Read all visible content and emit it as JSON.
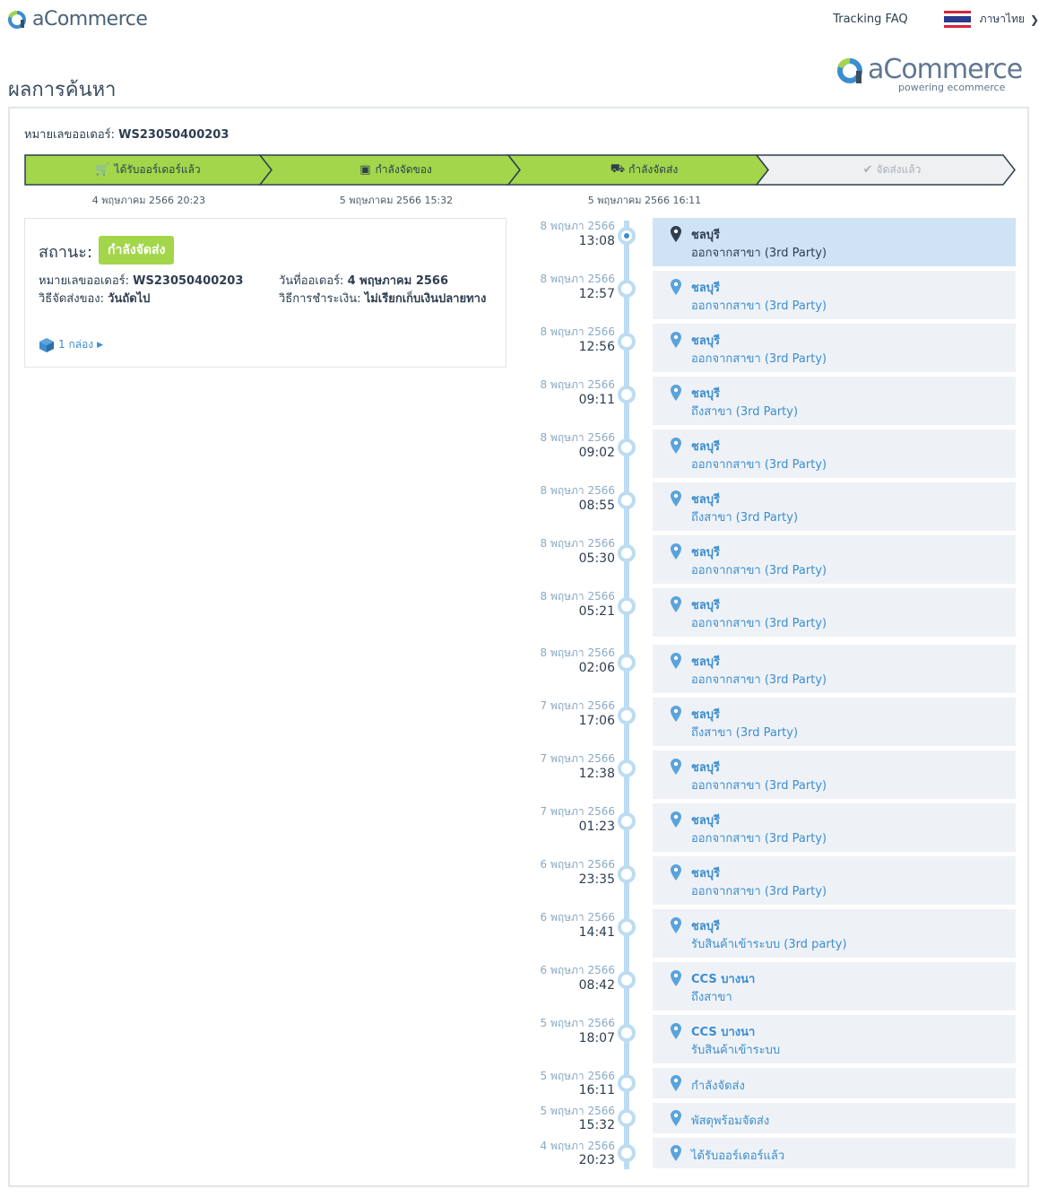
{
  "header": {
    "brand": "aCommerce",
    "faq": "Tracking FAQ",
    "language": "ภาษาไทย"
  },
  "page_title": "ผลการค้นหา",
  "big_logo": {
    "name": "aCommerce",
    "tagline": "powering ecommerce"
  },
  "order": {
    "label": "หมายเลขออเดอร์:",
    "number": "WS23050400203"
  },
  "steps": [
    {
      "label": "ได้รับออร์เดอร์แล้ว",
      "date": "4 พฤษภาคม 2566 20:23",
      "done": true
    },
    {
      "label": "กำลังจัดของ",
      "date": "5 พฤษภาคม 2566 15:32",
      "done": true
    },
    {
      "label": "กำลังจัดส่ง",
      "date": "5 พฤษภาคม 2566 16:11",
      "done": true
    },
    {
      "label": "จัดส่งแล้ว",
      "date": "",
      "done": false
    }
  ],
  "status": {
    "label": "สถานะ:",
    "badge": "กำลังจัดส่ง",
    "order_label": "หมายเลขออเดอร์:",
    "order_value": "WS23050400203",
    "ship_label": "วิธีจัดส่งของ:",
    "ship_value": "วันถัดไป",
    "date_label": "วันที่ออเดอร์:",
    "date_value": "4 พฤษภาคม 2566",
    "pay_label": "วิธีการชำระเงิน:",
    "pay_value": "ไม่เรียกเก็บเงินปลายทาง",
    "boxes": "1 กล่อง"
  },
  "events": [
    {
      "date": "8 พฤษภา 2566",
      "time": "13:08",
      "place": "ชลบุรี",
      "desc": "ออกจากสาขา (3rd Party)",
      "active": true
    },
    {
      "date": "8 พฤษภา 2566",
      "time": "12:57",
      "place": "ชลบุรี",
      "desc": "ออกจากสาขา (3rd Party)"
    },
    {
      "date": "8 พฤษภา 2566",
      "time": "12:56",
      "place": "ชลบุรี",
      "desc": "ออกจากสาขา (3rd Party)"
    },
    {
      "date": "8 พฤษภา 2566",
      "time": "09:11",
      "place": "ชลบุรี",
      "desc": "ถึงสาขา (3rd Party)"
    },
    {
      "date": "8 พฤษภา 2566",
      "time": "09:02",
      "place": "ชลบุรี",
      "desc": "ออกจากสาขา (3rd Party)"
    },
    {
      "date": "8 พฤษภา 2566",
      "time": "08:55",
      "place": "ชลบุรี",
      "desc": "ถึงสาขา (3rd Party)"
    },
    {
      "date": "8 พฤษภา 2566",
      "time": "05:30",
      "place": "ชลบุรี",
      "desc": "ออกจากสาขา (3rd Party)"
    },
    {
      "date": "8 พฤษภา 2566",
      "time": "05:21",
      "place": "ชลบุรี",
      "desc": "ออกจากสาขา (3rd Party)"
    },
    {
      "date": "8 พฤษภา 2566",
      "time": "02:06",
      "place": "ชลบุรี",
      "desc": "ออกจากสาขา (3rd Party)"
    },
    {
      "date": "7 พฤษภา 2566",
      "time": "17:06",
      "place": "ชลบุรี",
      "desc": "ถึงสาขา (3rd Party)"
    },
    {
      "date": "7 พฤษภา 2566",
      "time": "12:38",
      "place": "ชลบุรี",
      "desc": "ออกจากสาขา (3rd Party)"
    },
    {
      "date": "7 พฤษภา 2566",
      "time": "01:23",
      "place": "ชลบุรี",
      "desc": "ออกจากสาขา (3rd Party)"
    },
    {
      "date": "6 พฤษภา 2566",
      "time": "23:35",
      "place": "ชลบุรี",
      "desc": "ออกจากสาขา (3rd Party)"
    },
    {
      "date": "6 พฤษภา 2566",
      "time": "14:41",
      "place": "ชลบุรี",
      "desc": "รับสินค้าเข้าระบบ (3rd party)"
    },
    {
      "date": "6 พฤษภา 2566",
      "time": "08:42",
      "place": "CCS บางนา",
      "desc": "ถึงสาขา"
    },
    {
      "date": "5 พฤษภา 2566",
      "time": "18:07",
      "place": "CCS บางนา",
      "desc": "รับสินค้าเข้าระบบ"
    },
    {
      "date": "5 พฤษภา 2566",
      "time": "16:11",
      "place": "",
      "desc": "กำลังจัดส่ง"
    },
    {
      "date": "5 พฤษภา 2566",
      "time": "15:32",
      "place": "",
      "desc": "พัสดุพร้อมจัดส่ง"
    },
    {
      "date": "4 พฤษภา 2566",
      "time": "20:23",
      "place": "",
      "desc": "ได้รับออร์เดอร์แล้ว"
    }
  ],
  "colors": {
    "accent_green": "#a3d64a",
    "link_blue": "#3c8dd0",
    "timeline": "#bcdcf2"
  }
}
